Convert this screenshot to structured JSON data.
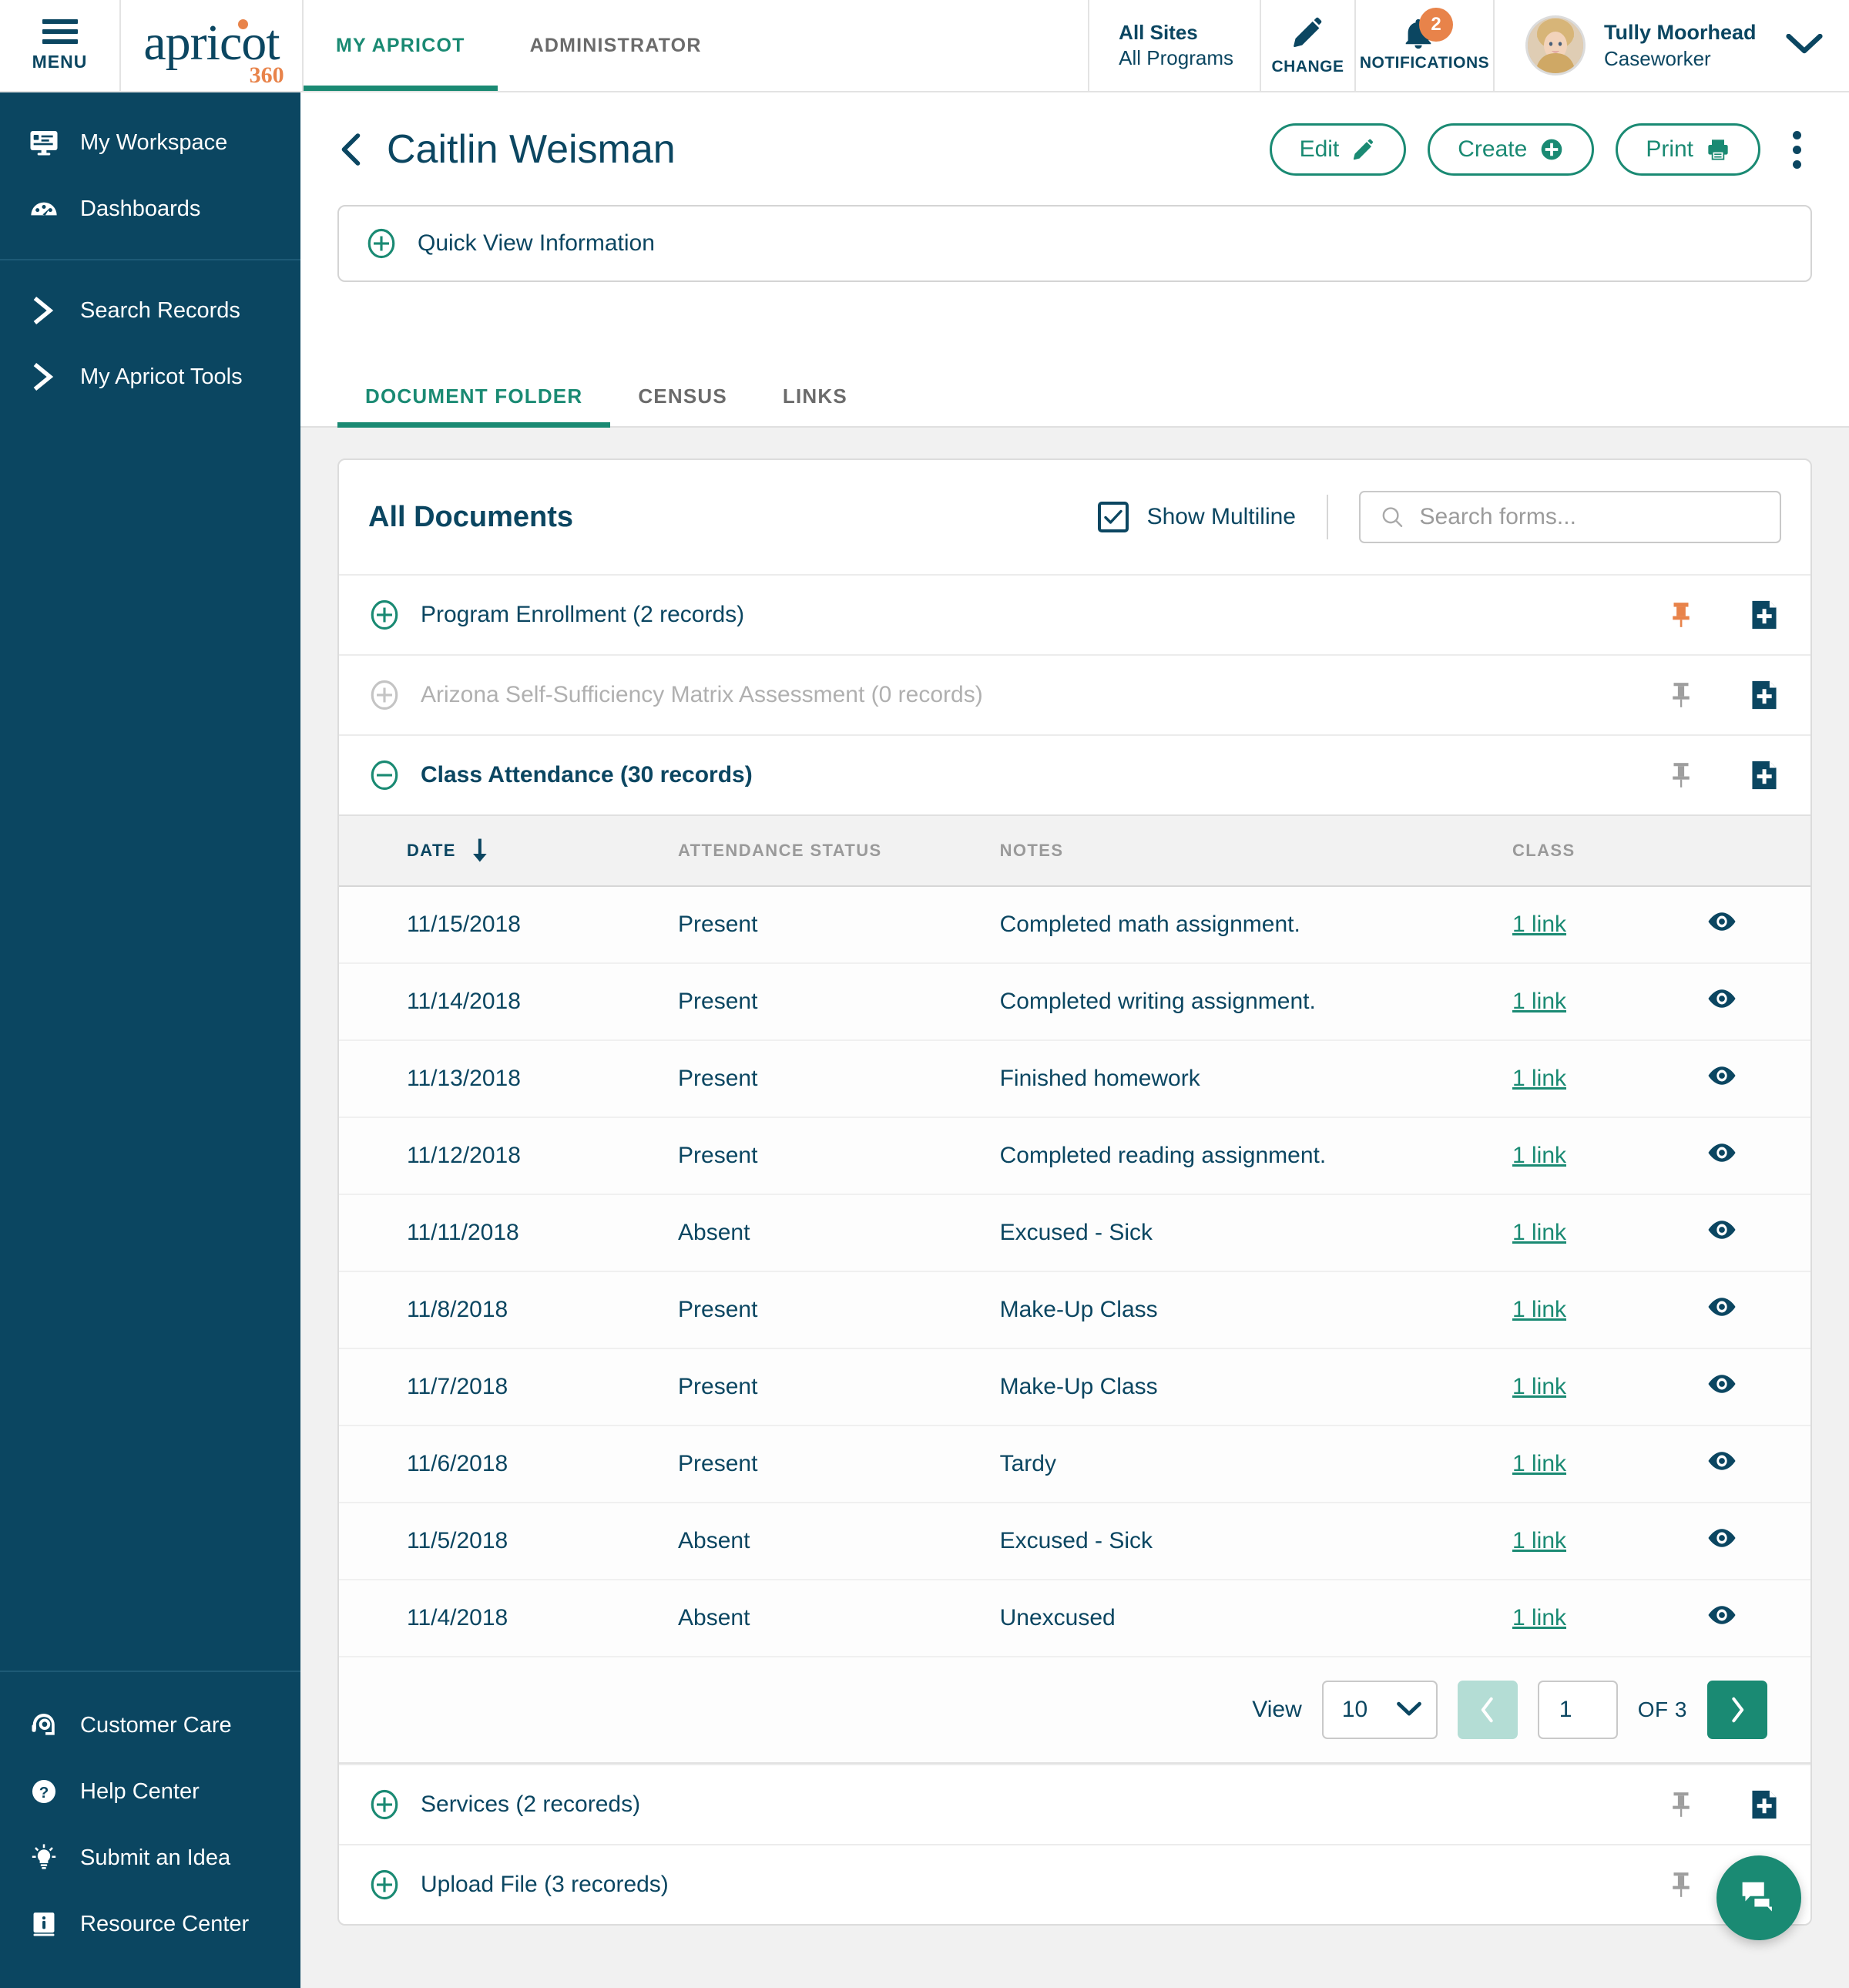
{
  "topbar": {
    "menu_label": "MENU",
    "logo_word": "apricot",
    "logo_suffix": "360",
    "tabs": [
      {
        "label": "MY APRICOT",
        "active": true
      },
      {
        "label": "ADMINISTRATOR",
        "active": false
      }
    ],
    "sites": {
      "line1": "All Sites",
      "line2": "All Programs"
    },
    "change_label": "CHANGE",
    "notifications_label": "NOTIFICATIONS",
    "notifications_count": "2",
    "user": {
      "name": "Tully Moorhead",
      "role": "Caseworker"
    }
  },
  "sidebar": {
    "top_items": [
      {
        "label": "My Workspace",
        "icon": "workspace-icon"
      },
      {
        "label": "Dashboards",
        "icon": "dashboard-icon"
      }
    ],
    "mid_items": [
      {
        "label": "Search Records",
        "icon": "chevron-right-icon"
      },
      {
        "label": "My Apricot Tools",
        "icon": "chevron-right-icon"
      }
    ],
    "bottom_items": [
      {
        "label": "Customer Care",
        "icon": "headset-icon"
      },
      {
        "label": "Help Center",
        "icon": "question-circle-icon"
      },
      {
        "label": "Submit an Idea",
        "icon": "lightbulb-icon"
      },
      {
        "label": "Resource Center",
        "icon": "book-info-icon"
      }
    ]
  },
  "page": {
    "title": "Caitlin Weisman",
    "back_icon": "chevron-left-icon",
    "actions": [
      {
        "label": "Edit",
        "icon": "pencil-icon"
      },
      {
        "label": "Create",
        "icon": "plus-circle-icon"
      },
      {
        "label": "Print",
        "icon": "printer-icon"
      }
    ],
    "kebab_icon": "more-vertical-icon",
    "quick_view_label": "Quick View Information",
    "tabs": [
      {
        "label": "DOCUMENT FOLDER",
        "active": true
      },
      {
        "label": "CENSUS",
        "active": false
      },
      {
        "label": "LINKS",
        "active": false
      }
    ]
  },
  "documents": {
    "card_title": "All Documents",
    "show_multiline_label": "Show Multiline",
    "show_multiline_checked": true,
    "search_placeholder": "Search forms...",
    "search_value": "",
    "folders_before": [
      {
        "label": "Program Enrollment (2 records)",
        "expanded": false,
        "disabled": false,
        "pinned": true
      },
      {
        "label": "Arizona Self-Sufficiency Matrix Assessment (0 records)",
        "expanded": false,
        "disabled": true,
        "pinned": false
      },
      {
        "label": "Class Attendance (30 records)",
        "expanded": true,
        "disabled": false,
        "pinned": false
      }
    ],
    "folders_after": [
      {
        "label": "Services (2 recoreds)",
        "expanded": false,
        "disabled": false,
        "pinned": false
      },
      {
        "label": "Upload File (3 recoreds)",
        "expanded": false,
        "disabled": false,
        "pinned": false
      }
    ]
  },
  "table": {
    "columns": [
      "DATE",
      "ATTENDANCE STATUS",
      "NOTES",
      "CLASS"
    ],
    "sort_column": "DATE",
    "sort_direction": "desc",
    "rows": [
      {
        "date": "11/15/2018",
        "status": "Present",
        "notes": "Completed math assignment.",
        "class": "1 link"
      },
      {
        "date": "11/14/2018",
        "status": "Present",
        "notes": "Completed writing assignment.",
        "class": "1 link"
      },
      {
        "date": "11/13/2018",
        "status": "Present",
        "notes": "Finished homework",
        "class": "1 link"
      },
      {
        "date": "11/12/2018",
        "status": "Present",
        "notes": "Completed reading assignment.",
        "class": "1 link"
      },
      {
        "date": "11/11/2018",
        "status": "Absent",
        "notes": "Excused - Sick",
        "class": "1 link"
      },
      {
        "date": "11/8/2018",
        "status": "Present",
        "notes": "Make-Up Class",
        "class": "1 link"
      },
      {
        "date": "11/7/2018",
        "status": "Present",
        "notes": "Make-Up Class",
        "class": "1 link"
      },
      {
        "date": "11/6/2018",
        "status": "Present",
        "notes": "Tardy",
        "class": "1 link"
      },
      {
        "date": "11/5/2018",
        "status": "Absent",
        "notes": "Excused - Sick",
        "class": "1 link"
      },
      {
        "date": "11/4/2018",
        "status": "Absent",
        "notes": "Unexcused",
        "class": "1 link"
      }
    ]
  },
  "pagination": {
    "view_label": "View",
    "page_size": "10",
    "current_page": "1",
    "of_label": "OF 3"
  },
  "chat": {
    "icon": "chat-bubble-icon"
  },
  "colors": {
    "brand_teal": "#1a8a73",
    "navy": "#0b4661",
    "accent_orange": "#e8834a",
    "muted_gray": "#9a9a9a"
  }
}
